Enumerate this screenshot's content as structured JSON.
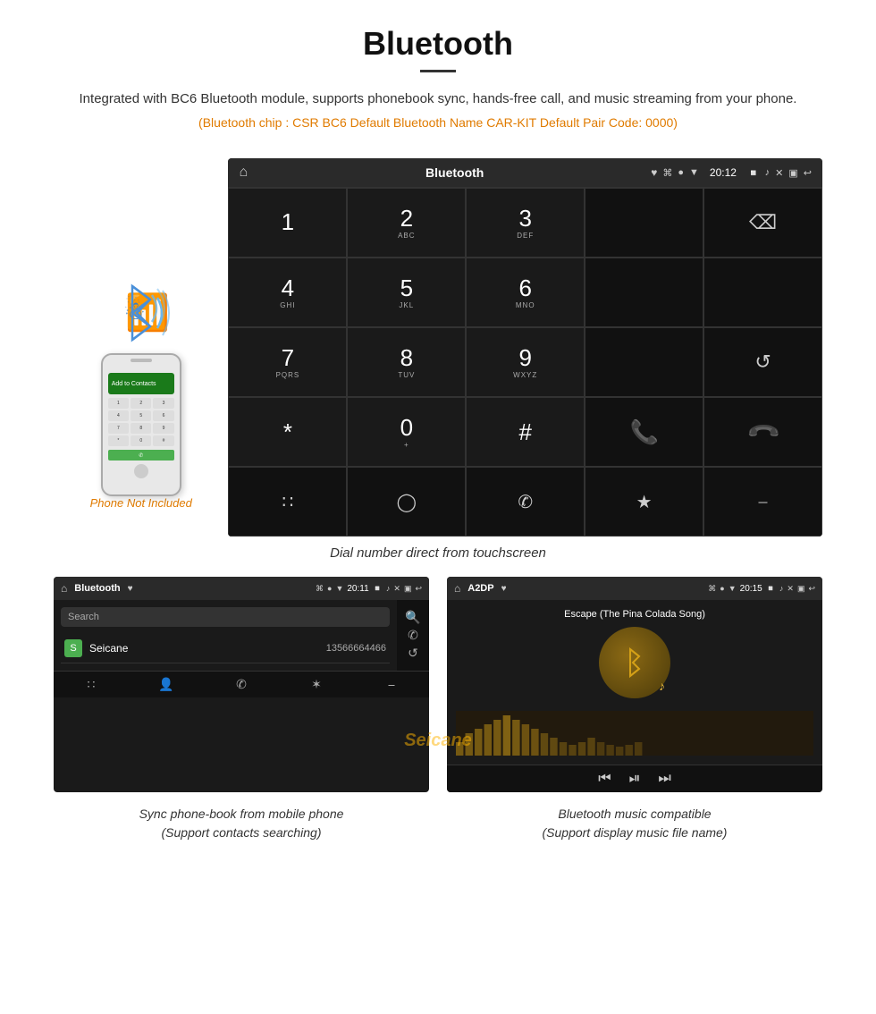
{
  "header": {
    "title": "Bluetooth",
    "description": "Integrated with BC6 Bluetooth module, supports phonebook sync, hands-free call, and music streaming from your phone.",
    "specs": "(Bluetooth chip : CSR BC6    Default Bluetooth Name CAR-KIT    Default Pair Code: 0000)"
  },
  "phone_label": "Phone Not Included",
  "dial_screen": {
    "status_title": "Bluetooth",
    "status_time": "20:12",
    "keys": [
      {
        "num": "1",
        "sub": ""
      },
      {
        "num": "2",
        "sub": "ABC"
      },
      {
        "num": "3",
        "sub": "DEF"
      },
      {
        "num": "",
        "sub": ""
      },
      {
        "num": "⌫",
        "sub": ""
      },
      {
        "num": "4",
        "sub": "GHI"
      },
      {
        "num": "5",
        "sub": "JKL"
      },
      {
        "num": "6",
        "sub": "MNO"
      },
      {
        "num": "",
        "sub": ""
      },
      {
        "num": "",
        "sub": ""
      },
      {
        "num": "7",
        "sub": "PQRS"
      },
      {
        "num": "8",
        "sub": "TUV"
      },
      {
        "num": "9",
        "sub": "WXYZ"
      },
      {
        "num": "",
        "sub": ""
      },
      {
        "num": "↺",
        "sub": ""
      },
      {
        "num": "*",
        "sub": ""
      },
      {
        "num": "0",
        "sub": "+"
      },
      {
        "num": "#",
        "sub": ""
      },
      {
        "num": "📞",
        "sub": ""
      },
      {
        "num": "📵",
        "sub": ""
      }
    ]
  },
  "dial_caption": "Dial number direct from touchscreen",
  "phonebook_screen": {
    "status_title": "Bluetooth",
    "status_time": "20:11",
    "search_placeholder": "Search",
    "contact_letter": "S",
    "contact_name": "Seicane",
    "contact_number": "13566664466"
  },
  "music_screen": {
    "status_title": "A2DP",
    "status_time": "20:15",
    "song_title": "Escape (The Pina Colada Song)"
  },
  "bottom_captions": {
    "left": "Sync phone-book from mobile phone\n(Support contacts searching)",
    "right": "Bluetooth music compatible\n(Support display music file name)"
  },
  "watermark": "Seicane"
}
